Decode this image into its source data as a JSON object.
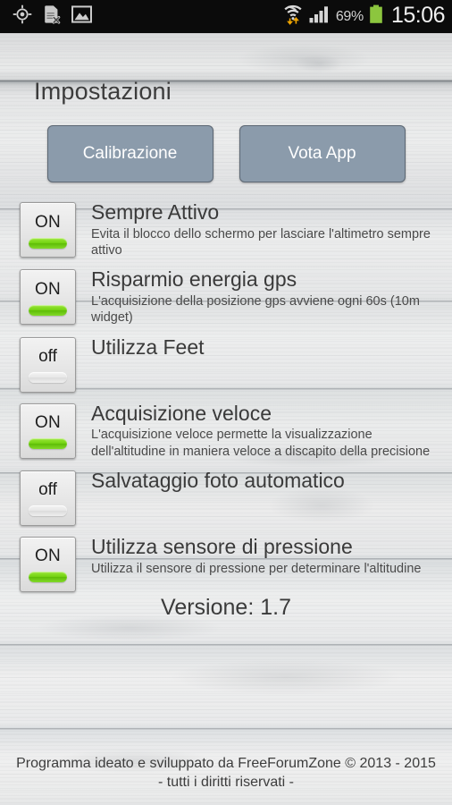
{
  "statusbar": {
    "icons_left": [
      "gps-location-icon",
      "sim-card-disabled-icon",
      "image-gallery-icon"
    ],
    "icons_right": [
      "wifi-transfer-icon",
      "cellular-signal-icon",
      "battery-icon"
    ],
    "battery_percent": "69%",
    "clock": "15:06"
  },
  "header": {
    "title": "Impostazioni"
  },
  "buttons": {
    "calibration_label": "Calibrazione",
    "rate_app_label": "Vota App",
    "color": "#8b9bab"
  },
  "settings": [
    {
      "state_label": "ON",
      "state": "on",
      "title": "Sempre Attivo",
      "subtitle": "Evita il blocco dello schermo per lasciare l'altimetro sempre attivo"
    },
    {
      "state_label": "ON",
      "state": "on",
      "title": "Risparmio energia gps",
      "subtitle": "L'acquisizione della posizione gps avviene ogni 60s (10m widget)"
    },
    {
      "state_label": "off",
      "state": "off",
      "title": "Utilizza Feet",
      "subtitle": ""
    },
    {
      "state_label": "ON",
      "state": "on",
      "title": "Acquisizione veloce",
      "subtitle": "L'acquisizione veloce permette la visualizzazione dell'altitudine in maniera veloce a discapito della precisione"
    },
    {
      "state_label": "off",
      "state": "off",
      "title": "Salvataggio foto automatico",
      "subtitle": ""
    },
    {
      "state_label": "ON",
      "state": "on",
      "title": "Utilizza sensore di pressione",
      "subtitle": "Utilizza il sensore di pressione per determinare l'altitudine"
    }
  ],
  "version": {
    "text": "Versione: 1.7"
  },
  "footer": {
    "text": "Programma ideato e sviluppato da FreeForumZone © 2013 - 2015 - tutti i diritti riservati -"
  },
  "colors": {
    "toggle_on": "#73d211",
    "background": "#e7e8e9",
    "text": "#3a3a3a"
  }
}
